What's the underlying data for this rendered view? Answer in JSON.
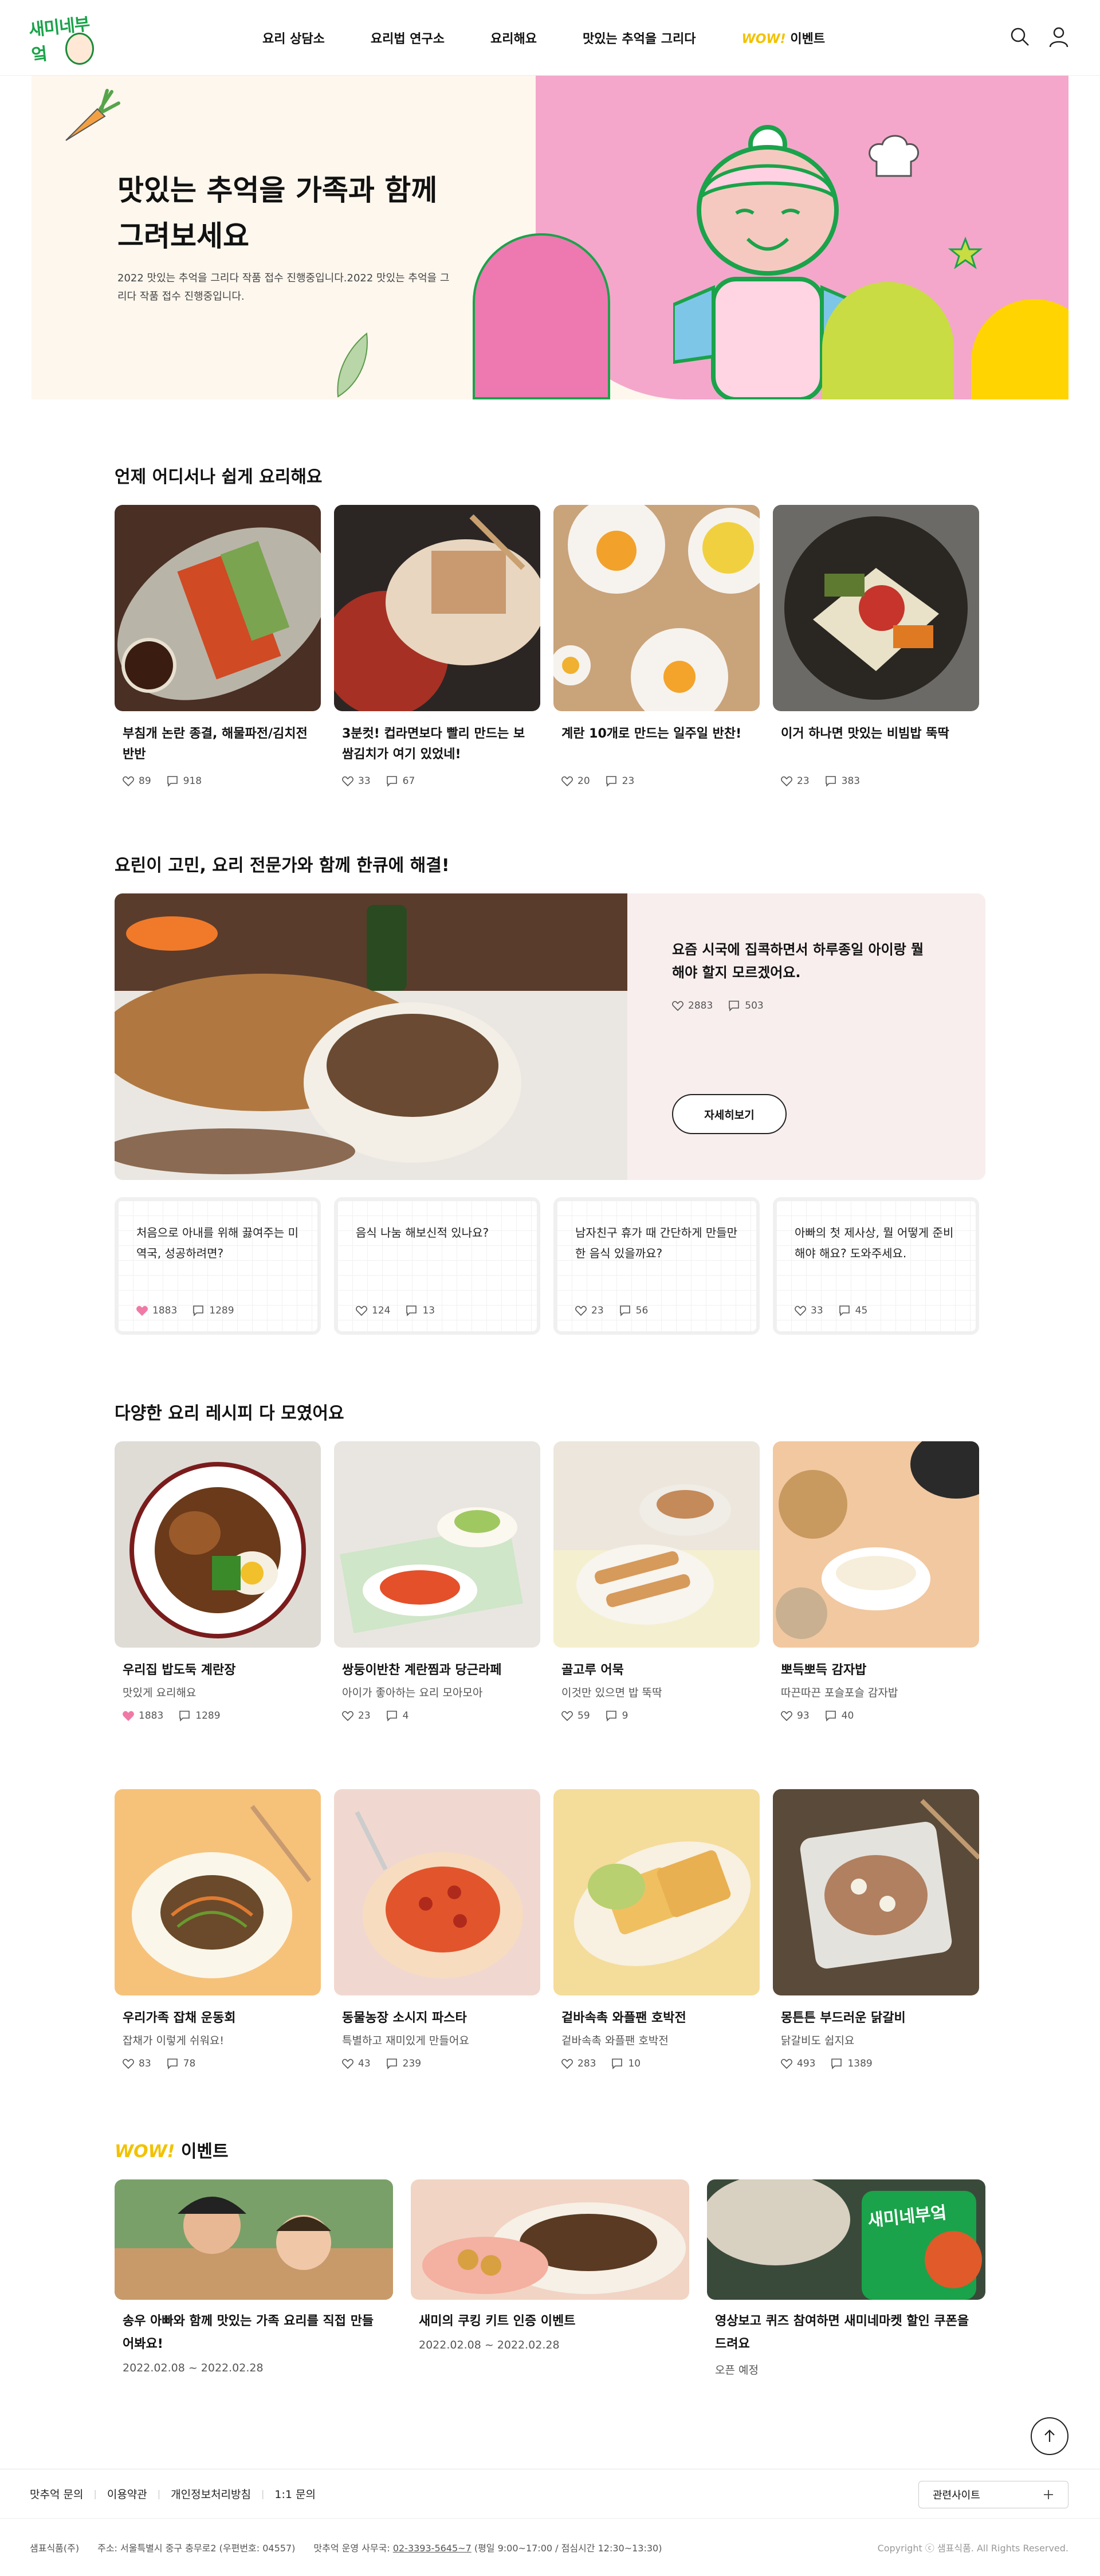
{
  "brand": "새미네부엌",
  "nav": {
    "items": [
      "요리 상담소",
      "요리법 연구소",
      "요리해요",
      "맛있는 추억을 그리다"
    ],
    "event_wow": "WOW!",
    "event_label": "이벤트"
  },
  "hero": {
    "title_line1": "맛있는 추억을 가족과 함께",
    "title_line2": "그려보세요",
    "desc": "2022 맛있는 추억을 그리다 작품 접수 진행중입니다.2022 맛있는 추억을 그리다 작품 접수 진행중입니다."
  },
  "easy": {
    "title": "언제 어디서나 쉽게 요리해요",
    "cards": [
      {
        "title": "부침개 논란 종결, 해물파전/김치전 반반",
        "likes": "89",
        "comments": "918"
      },
      {
        "title": "3분컷! 컵라면보다 빨리 만드는 보쌈김치가 여기 있었네!",
        "likes": "33",
        "comments": "67"
      },
      {
        "title": "계란 10개로 만드는 일주일 반찬!",
        "likes": "20",
        "comments": "23"
      },
      {
        "title": "이거 하나면 맛있는 비빔밥 뚝딱",
        "likes": "23",
        "comments": "383"
      }
    ]
  },
  "expert": {
    "title": "요린이 고민, 요리 전문가와 함께 한큐에 해결!",
    "feature_question": "요즘 시국에 집콕하면서 하루종일 아이랑 뭘 해야 할지 모르겠어요.",
    "feature_likes": "2883",
    "feature_comments": "503",
    "more_label": "자세히보기",
    "questions": [
      {
        "text": "처음으로 아내를 위해 끓여주는 미역국, 성공하려면?",
        "likes": "1883",
        "comments": "1289",
        "liked": true
      },
      {
        "text": "음식 나눔 해보신적 있나요?",
        "likes": "124",
        "comments": "13",
        "liked": false
      },
      {
        "text": "남자친구 휴가 때 간단하게 만들만 한 음식 있을까요?",
        "likes": "23",
        "comments": "56",
        "liked": false
      },
      {
        "text": "아빠의 첫 제사상, 뭘 어떻게 준비해야 해요? 도와주세요.",
        "likes": "33",
        "comments": "45",
        "liked": false
      }
    ]
  },
  "recipes": {
    "title": "다양한 요리 레시피 다 모였어요",
    "row1": [
      {
        "title": "우리집 밥도둑 계란장",
        "sub": "맛있게 요리해요",
        "likes": "1883",
        "comments": "1289",
        "liked": true
      },
      {
        "title": "쌍둥이반찬 계란찜과 당근라페",
        "sub": "아이가 좋아하는 요리 모아모아",
        "likes": "23",
        "comments": "4",
        "liked": false
      },
      {
        "title": "골고루 어묵",
        "sub": "이것만 있으면 밥 뚝딱",
        "likes": "59",
        "comments": "9",
        "liked": false
      },
      {
        "title": "뽀득뽀득 감자밥",
        "sub": "따끈따끈 포슬포슬 감자밥",
        "likes": "93",
        "comments": "40",
        "liked": false
      }
    ],
    "row2": [
      {
        "title": "우리가족 잡채 운동회",
        "sub": "잡채가 이렇게 쉬워요!",
        "likes": "83",
        "comments": "78",
        "liked": false
      },
      {
        "title": "동물농장 소시지 파스타",
        "sub": "특별하고 재미있게 만들어요",
        "likes": "43",
        "comments": "239",
        "liked": false
      },
      {
        "title": "겉바속촉 와플팬 호박전",
        "sub": "겉바속촉 와플팬 호박전",
        "likes": "283",
        "comments": "10",
        "liked": false
      },
      {
        "title": "몽튼튼 부드러운 닭갈비",
        "sub": "닭갈비도 쉽지요",
        "likes": "493",
        "comments": "1389",
        "liked": false
      }
    ]
  },
  "events": {
    "wow": "WOW!",
    "title": "이벤트",
    "items": [
      {
        "title": "송우 아빠와 함께 맛있는 가족 요리를 직접 만들어봐요!",
        "date": "2022.02.08 ~ 2022.02.28"
      },
      {
        "title": "새미의 쿠킹 키트 인증 이벤트",
        "date": "2022.02.08 ~ 2022.02.28"
      },
      {
        "title": "영상보고 퀴즈 참여하면 새미네마켓 할인 쿠폰을 드려요",
        "date": "오픈 예정"
      }
    ],
    "banner_text": "새미네부엌"
  },
  "footer": {
    "links": [
      "맛추억 문의",
      "이용약관",
      "개인정보처리방침",
      "1:1 문의"
    ],
    "related": "관련사이트",
    "company": "샘표식품(주)",
    "address": "주소: 서울특별시 중구 충무로2 (우편번호: 04557)",
    "office_label": "맛추억 운영 사무국:",
    "tel": "02-3393-5645~7",
    "hours": "(평일 9:00~17:00 / 점심시간 12:30~13:30)",
    "copyright": "Copyright ⓒ 샘표식품. All Rights Reserved."
  },
  "colors": {
    "brand_green": "#1aa34a",
    "hero_pink": "#f4a7cb",
    "wow_yellow": "#f2c200",
    "like_pink": "#f07aa6"
  }
}
